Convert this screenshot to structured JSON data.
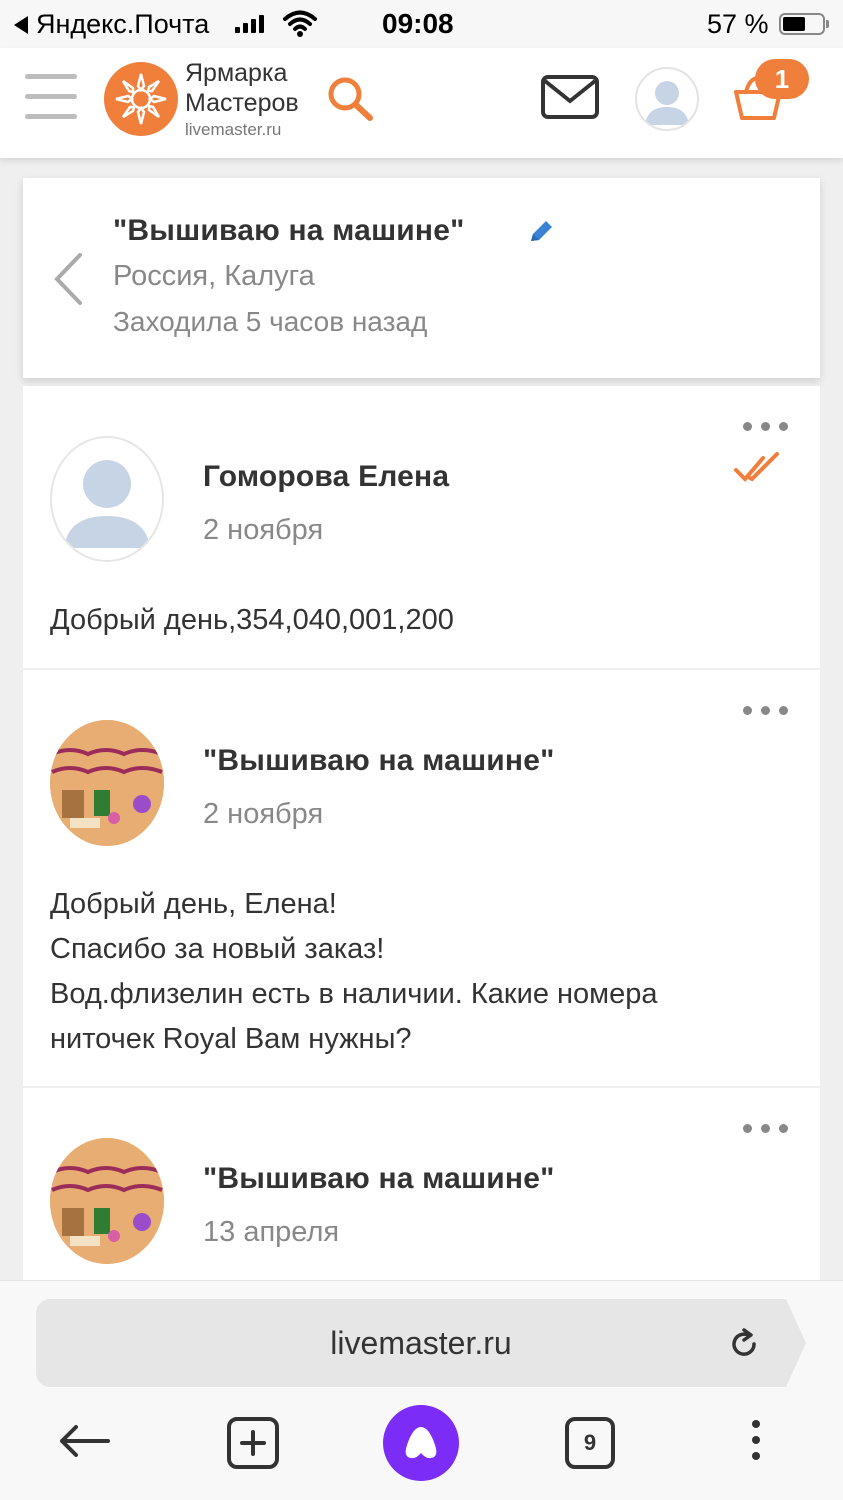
{
  "status_bar": {
    "back_app": "Яндекс.Почта",
    "time": "09:08",
    "battery_text": "57 %",
    "battery_level": 0.57
  },
  "header": {
    "logo_line1": "Ярмарка",
    "logo_line2": "Мастеров",
    "logo_domain": "livemaster.ru",
    "cart_count": "1",
    "accent_color": "#f07f3c"
  },
  "conversation": {
    "title": "\"Вышиваю на машине\"",
    "location": "Россия, Калуга",
    "last_seen": "Заходила 5 часов назад"
  },
  "messages": [
    {
      "sender": "Гоморова Елена",
      "date": "2 ноября",
      "lines": [
        "Добрый день,354,040,001,200"
      ],
      "read": true
    },
    {
      "sender": "\"Вышиваю на машине\"",
      "date": "2 ноября",
      "lines": [
        "Добрый день, Елена!",
        "Спасибо за новый заказ!",
        "Вод.флизелин есть в наличии. Какие номера",
        "ниточек Royal Вам нужны?"
      ]
    },
    {
      "sender": "\"Вышиваю на машине\"",
      "date": "13 апреля",
      "lines": []
    }
  ],
  "browser": {
    "url": "livemaster.ru",
    "tab_count": "9"
  }
}
